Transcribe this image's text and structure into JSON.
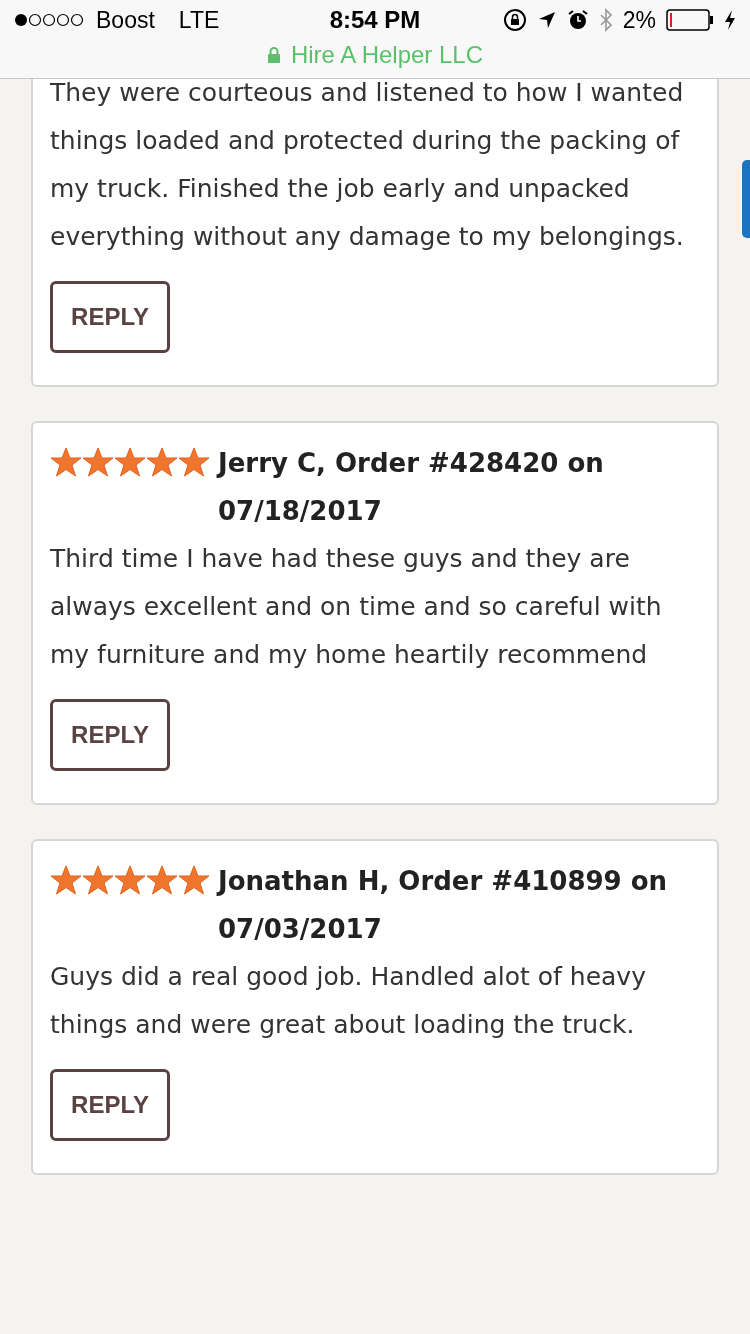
{
  "status_bar": {
    "carrier": "Boost",
    "network": "LTE",
    "time": "8:54 PM",
    "battery_percent": "2%",
    "site": "Hire A Helper LLC"
  },
  "reviews": [
    {
      "kind": "cut_off",
      "text": "They were courteous and listened to how I wanted things loaded and protected during the packing of my truck. Finished the job early and unpacked everything without any damage to my belongings.",
      "button": "REPLY"
    },
    {
      "kind": "full",
      "header": "Jerry C, Order #428420 on 07/18/2017",
      "stars": 5,
      "text": "Third time I have had these guys and they are always excellent and on time and so careful with my furniture and my home heartily recommend",
      "button": "REPLY"
    },
    {
      "kind": "full",
      "header": "Jonathan H, Order #410899 on 07/03/2017",
      "stars": 5,
      "text": "Guys did a real good job. Handled alot of heavy things and were great about loading the truck.",
      "button": "REPLY"
    }
  ]
}
